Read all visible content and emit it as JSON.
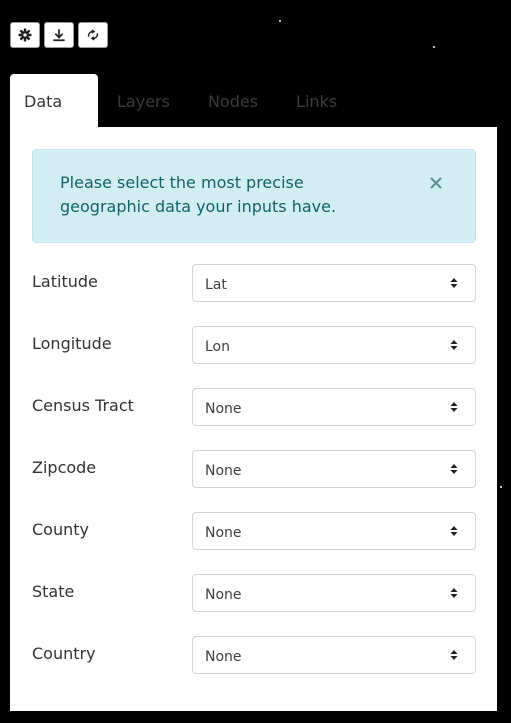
{
  "toolbar": {
    "buttons": [
      {
        "icon": "gear-icon"
      },
      {
        "icon": "download-icon"
      },
      {
        "icon": "sync-icon"
      }
    ]
  },
  "tabs": [
    {
      "label": "Data",
      "active": true
    },
    {
      "label": "Layers",
      "active": false
    },
    {
      "label": "Nodes",
      "active": false
    },
    {
      "label": "Links",
      "active": false
    }
  ],
  "alert": {
    "message": "Please select the most precise geographic data your inputs have.",
    "close_icon": "close-icon"
  },
  "fields": [
    {
      "label": "Latitude",
      "value": "Lat"
    },
    {
      "label": "Longitude",
      "value": "Lon"
    },
    {
      "label": "Census Tract",
      "value": "None"
    },
    {
      "label": "Zipcode",
      "value": "None"
    },
    {
      "label": "County",
      "value": "None"
    },
    {
      "label": "State",
      "value": "None"
    },
    {
      "label": "Country",
      "value": "None"
    }
  ],
  "colors": {
    "background": "#000000",
    "panel": "#ffffff",
    "alert_bg": "#d2eef2",
    "alert_text": "#13616b"
  }
}
